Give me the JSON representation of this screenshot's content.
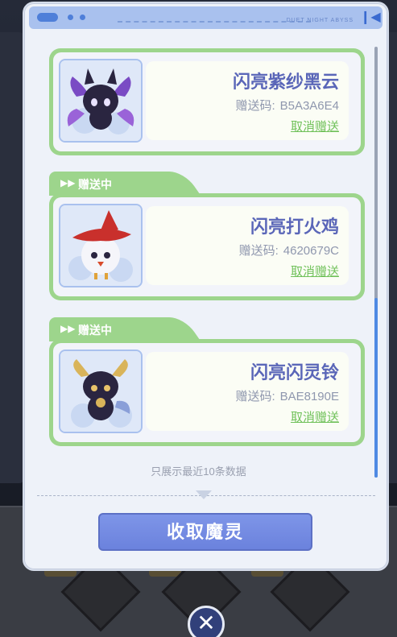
{
  "header": {
    "brand": "DUET NIGHT ABYSS",
    "collapse_icon": "collapse-icon"
  },
  "gifts": [
    {
      "status": "",
      "name": "闪亮紫纱黑云",
      "code_label": "赠送码:",
      "code": "B5A3A6E4",
      "cancel_label": "取消赠送",
      "avatar": "purple-cloud-pet"
    },
    {
      "status": "赠送中",
      "name": "闪亮打火鸡",
      "code_label": "赠送码:",
      "code": "4620679C",
      "cancel_label": "取消赠送",
      "avatar": "fire-hat-bird-pet"
    },
    {
      "status": "赠送中",
      "name": "闪亮闪灵铃",
      "code_label": "赠送码:",
      "code": "BAE8190E",
      "cancel_label": "取消赠送",
      "avatar": "horned-bell-pet"
    }
  ],
  "footer_note": "只展示最近10条数据",
  "collect_button": "收取魔灵",
  "close_icon": "close-icon",
  "colors": {
    "accent_green": "#9dd58c",
    "name_blue": "#5a66b8",
    "button_blue": "#7489e3",
    "header_blue": "#a9c1ee"
  }
}
